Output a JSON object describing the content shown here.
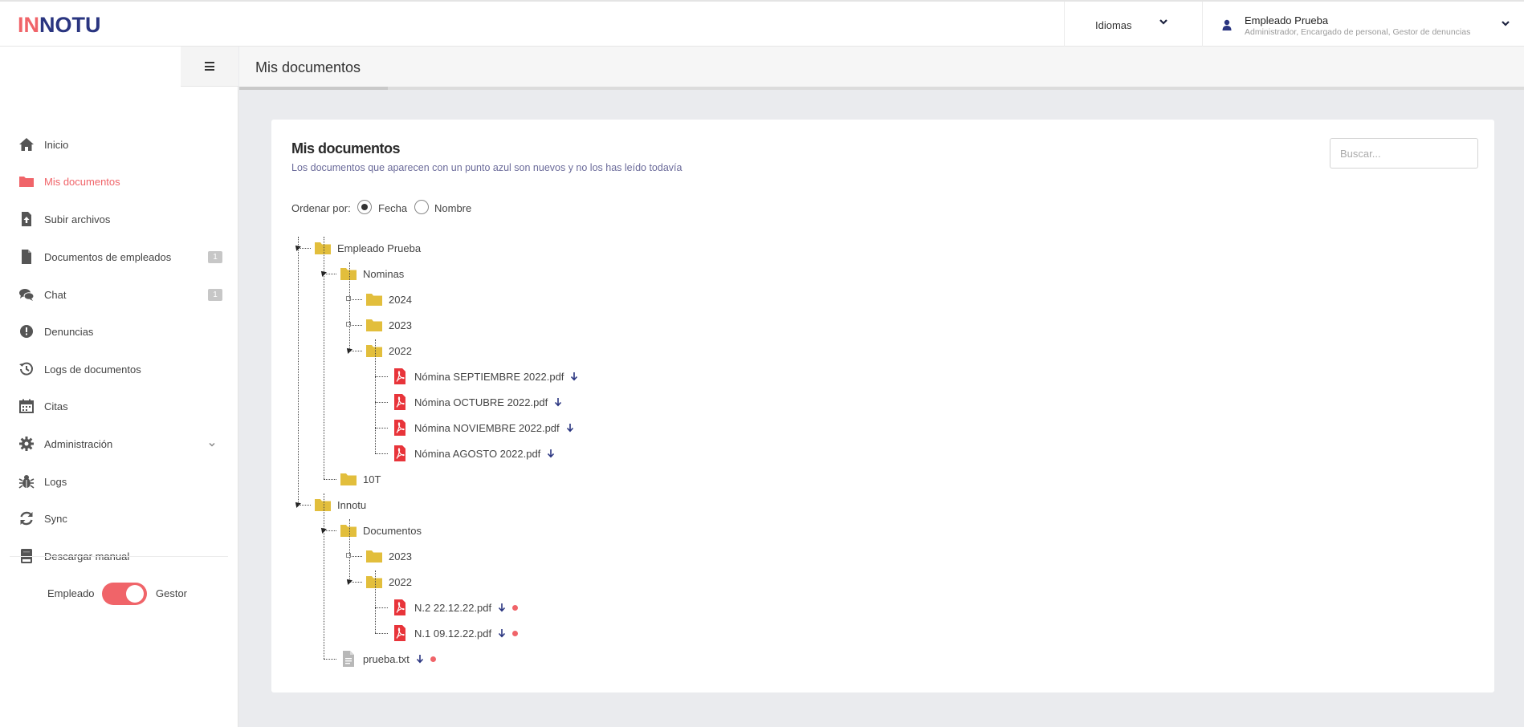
{
  "header": {
    "logo_text": "INNOTU",
    "language_label": "Idiomas",
    "user_name": "Empleado Prueba",
    "user_roles": "Administrador, Encargado de personal, Gestor de denuncias"
  },
  "sidebar": {
    "items": [
      {
        "label": "Inicio",
        "icon": "home-icon"
      },
      {
        "label": "Mis documentos",
        "icon": "folder-icon",
        "active": true
      },
      {
        "label": "Subir archivos",
        "icon": "upload-file-icon"
      },
      {
        "label": "Documentos de empleados",
        "icon": "file-icon",
        "badge": "1"
      },
      {
        "label": "Chat",
        "icon": "chat-icon",
        "badge": "1"
      },
      {
        "label": "Denuncias",
        "icon": "exclamation-icon"
      },
      {
        "label": "Logs de documentos",
        "icon": "history-icon"
      },
      {
        "label": "Citas",
        "icon": "calendar-icon"
      },
      {
        "label": "Administración",
        "icon": "gear-icon"
      },
      {
        "label": "Logs",
        "icon": "bug-icon"
      },
      {
        "label": "Sync",
        "icon": "sync-icon"
      },
      {
        "label": "Descargar manual",
        "icon": "book-icon"
      }
    ],
    "mode_left": "Empleado",
    "mode_right": "Gestor",
    "mode_on": true
  },
  "page": {
    "title": "Mis documentos"
  },
  "card": {
    "title": "Mis documentos",
    "description": "Los documentos que aparecen con un punto azul son nuevos y no los has leído todavía",
    "search_placeholder": "Buscar...",
    "sort_label": "Ordenar por:",
    "sort_options": [
      "Fecha",
      "Nombre"
    ],
    "sort_selected": "Fecha"
  },
  "tree": [
    {
      "type": "folder",
      "name": "Empleado Prueba"
    },
    {
      "type": "folder",
      "name": "Nominas"
    },
    {
      "type": "folder",
      "name": "2024"
    },
    {
      "type": "folder",
      "name": "2023"
    },
    {
      "type": "folder",
      "name": "2022"
    },
    {
      "type": "pdf",
      "name": "Nómina SEPTIEMBRE 2022.pdf"
    },
    {
      "type": "pdf",
      "name": "Nómina OCTUBRE 2022.pdf"
    },
    {
      "type": "pdf",
      "name": "Nómina NOVIEMBRE 2022.pdf"
    },
    {
      "type": "pdf",
      "name": "Nómina AGOSTO 2022.pdf"
    },
    {
      "type": "folder",
      "name": "10T"
    },
    {
      "type": "folder",
      "name": "Innotu"
    },
    {
      "type": "folder",
      "name": "Documentos"
    },
    {
      "type": "folder",
      "name": "2023"
    },
    {
      "type": "folder",
      "name": "2022"
    },
    {
      "type": "pdf",
      "name": "N.2 22.12.22.pdf",
      "new": true
    },
    {
      "type": "pdf",
      "name": "N.1 09.12.22.pdf",
      "new": true
    },
    {
      "type": "txt",
      "name": "prueba.txt",
      "new": true
    }
  ],
  "colors": {
    "accent": "#f06469",
    "brand": "#2a3580",
    "folder": "#e2be3c",
    "pdf": "#e8343a"
  }
}
